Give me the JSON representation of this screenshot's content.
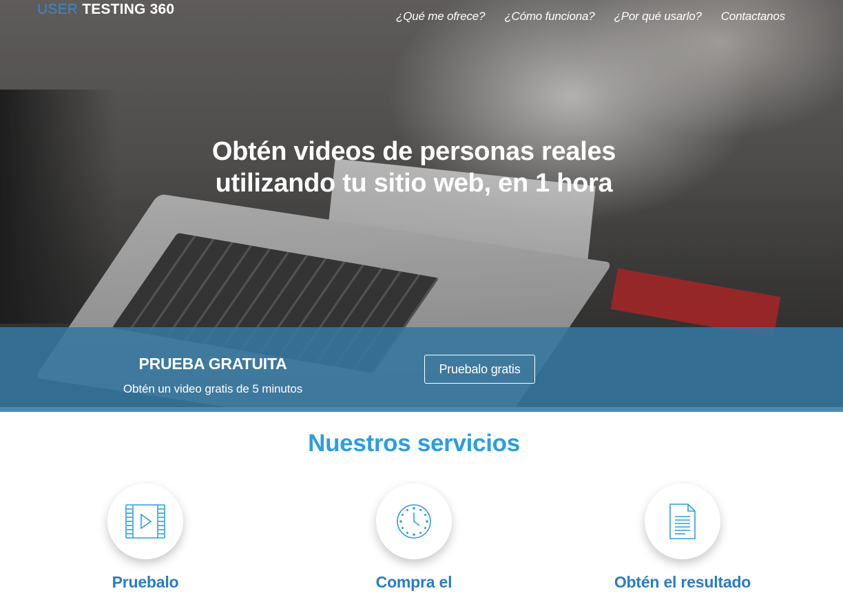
{
  "header": {
    "logo_part1": "USER",
    "logo_part2": " TESTING 360",
    "nav": [
      {
        "label": "¿Qué me ofrece?"
      },
      {
        "label": "¿Cómo funciona?"
      },
      {
        "label": "¿Por qué usarlo?"
      },
      {
        "label": "Contactanos"
      }
    ]
  },
  "hero": {
    "headline_line1": "Obtén videos de personas reales",
    "headline_line2": "utilizando tu sitio web, en 1 hora"
  },
  "trial": {
    "title": "PRUEBA GRATUITA",
    "subtitle": "Obtén un video gratis de 5 minutos",
    "button_label": "Pruebalo gratis"
  },
  "services": {
    "title": "Nuestros servicios",
    "items": [
      {
        "label": "Pruebalo",
        "icon": "video-film-icon"
      },
      {
        "label": "Compra el",
        "icon": "clock-icon"
      },
      {
        "label": "Obtén el resultado",
        "icon": "document-icon"
      }
    ]
  },
  "colors": {
    "accent": "#2b9ee0",
    "band": "#3476a0",
    "service_label": "#2a7bc7"
  }
}
